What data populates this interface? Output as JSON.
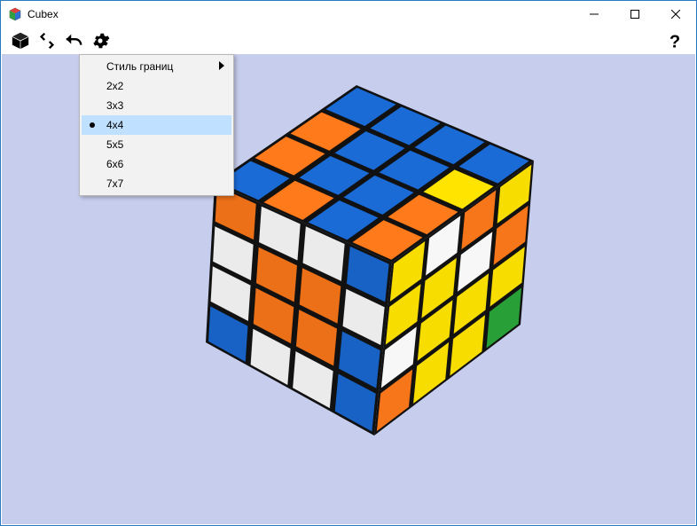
{
  "window": {
    "title": "Cubex"
  },
  "toolbar": {
    "cube_icon": "cube-icon",
    "scramble_icon": "scramble-icon",
    "undo_icon": "undo-icon",
    "settings_icon": "gear-icon",
    "help_icon": "help-icon"
  },
  "menu": {
    "items": [
      {
        "label": "Стиль границ",
        "submenu": true,
        "selected": false
      },
      {
        "label": "2x2",
        "submenu": false,
        "selected": false
      },
      {
        "label": "3x3",
        "submenu": false,
        "selected": false
      },
      {
        "label": "4x4",
        "submenu": false,
        "selected": true
      },
      {
        "label": "5x5",
        "submenu": false,
        "selected": false
      },
      {
        "label": "6x6",
        "submenu": false,
        "selected": false
      },
      {
        "label": "7x7",
        "submenu": false,
        "selected": false
      }
    ]
  },
  "cube": {
    "size": "4x4",
    "colors": {
      "blue": "#1a6bd6",
      "orange": "#ff7a1a",
      "yellow": "#ffe400",
      "white": "#ffffff",
      "green": "#2aa43a",
      "frame": "#111111"
    },
    "top_face": [
      [
        "blue",
        "blue",
        "blue",
        "blue"
      ],
      [
        "orange",
        "blue",
        "blue",
        "yellow"
      ],
      [
        "orange",
        "blue",
        "blue",
        "orange"
      ],
      [
        "blue",
        "orange",
        "blue",
        "orange"
      ]
    ],
    "front_face": [
      [
        "orange",
        "white",
        "white",
        "blue"
      ],
      [
        "white",
        "orange",
        "orange",
        "white"
      ],
      [
        "white",
        "orange",
        "orange",
        "blue"
      ],
      [
        "blue",
        "white",
        "white",
        "blue"
      ]
    ],
    "right_face": [
      [
        "yellow",
        "white",
        "orange",
        "yellow"
      ],
      [
        "yellow",
        "yellow",
        "white",
        "orange"
      ],
      [
        "white",
        "yellow",
        "yellow",
        "yellow"
      ],
      [
        "orange",
        "yellow",
        "yellow",
        "green"
      ]
    ]
  }
}
